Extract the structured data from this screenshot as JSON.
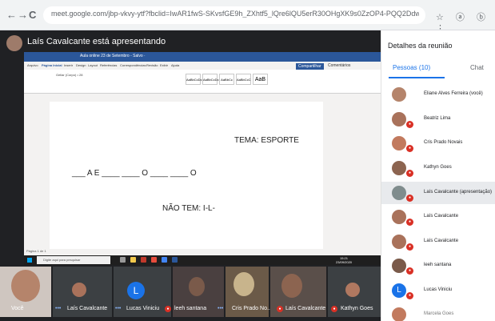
{
  "browser": {
    "url": "meet.google.com/jbp-vkvy-ytf?fbclid=IwAR1fwS-SKvsfGE9h_ZXhtf5_lQre6lQU5erR30OHgXK9s0ZzOP4-PQQ2Ddw",
    "back_glyph": "←",
    "forward_glyph": "→",
    "reload_glyph": "C",
    "ext_glyphs": "☆ ⓐ ⓑ ⋮"
  },
  "presentation": {
    "presenter_title": "Laís Cavalcante está apresentando",
    "word_title": "Aula online 23 de Setembro - Salvo ·",
    "share": "Compartilhar",
    "comments": "Comentários",
    "tabs": [
      "Arquivo",
      "Página Inicial",
      "Inserir",
      "Design",
      "Layout",
      "Referências",
      "Correspondências",
      "Revisão",
      "Exibir",
      "Ajuda"
    ],
    "font_name": "Gellar (Corpo) • 28",
    "styles": [
      "AaBbCcDc",
      "AaBbCcDc",
      "AaBbCc",
      "AaBbCcC",
      "AaB"
    ],
    "doc": {
      "tema": "TEMA: ESPORTE",
      "blanks": "___ A E ____ ____ O ____ ____ O",
      "nao_tem": "NÃO TEM:  I-L-"
    },
    "status": "Página 1 de 1",
    "taskbar_search": "Digite aqui para pesquisar",
    "clock_time": "15:21",
    "clock_date": "23/09/2020"
  },
  "strip": {
    "tiles": [
      {
        "name": "Você"
      },
      {
        "name": "Laís Cavalcante"
      },
      {
        "name": "Lucas Viniciu"
      },
      {
        "name": "leeh santana"
      },
      {
        "name": "Cris Prado No..."
      },
      {
        "name": "Laís Cavalcante"
      },
      {
        "name": "Kathyn Goes"
      }
    ],
    "more_glyph": "•••",
    "l_initial": "L"
  },
  "side_panel": {
    "title": "Detalhes da reunião",
    "people_tab": "Pessoas (10)",
    "chat_tab": "Chat",
    "participants": [
      {
        "name": "Eliane Alves Ferreira (você)"
      },
      {
        "name": "Beatriz Lima"
      },
      {
        "name": "Cris Prado Novais"
      },
      {
        "name": "Kathyn Goes"
      },
      {
        "name": "Laís Cavalcante (apresentação)"
      },
      {
        "name": "Laís Cavalcante"
      },
      {
        "name": "Laís Cavalcante"
      },
      {
        "name": "leeh santana"
      },
      {
        "name": "Lucas Viniciu"
      },
      {
        "name": "Marcela Goes"
      }
    ],
    "l_initial": "L"
  },
  "colors": {
    "meet_dark": "#202124",
    "word_blue": "#2b579a",
    "accent_blue": "#1a73e8",
    "mute_red": "#d93025"
  }
}
